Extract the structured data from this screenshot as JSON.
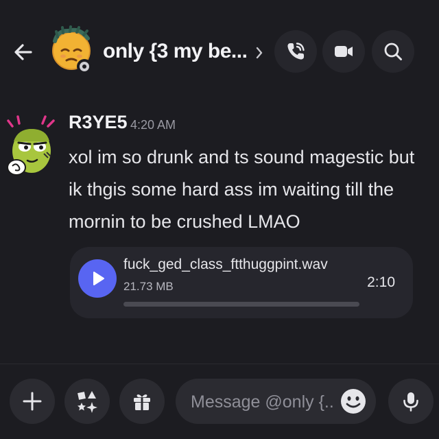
{
  "header": {
    "back_icon": "arrow-left-icon",
    "title": "only {3 my be...",
    "title_chevron_icon": "chevron-right-icon",
    "actions": [
      {
        "name": "voice-call",
        "icon": "phone-call-icon"
      },
      {
        "name": "video-call",
        "icon": "video-camera-icon"
      },
      {
        "name": "search",
        "icon": "search-icon"
      }
    ],
    "status": "idle"
  },
  "message": {
    "author": "R3YE5",
    "timestamp": "4:20 AM",
    "text": "xol im so drunk and ts sound magestic but ik thgis some hard ass im waiting till the mornin to be crushed LMAO",
    "attachment": {
      "type": "audio",
      "file_name": "fuck_ged_class_ftthuggpint.wav",
      "file_size": "21.73 MB",
      "duration": "2:10",
      "progress": 0,
      "play_icon": "play-icon"
    }
  },
  "composer": {
    "placeholder": "Message @only {...",
    "buttons": [
      {
        "name": "add",
        "icon": "plus-icon"
      },
      {
        "name": "apps",
        "icon": "apps-icon"
      },
      {
        "name": "gift",
        "icon": "gift-icon"
      },
      {
        "name": "voice-message",
        "icon": "microphone-icon"
      }
    ],
    "emoji_icon": "smiley-emoji-icon"
  },
  "colors": {
    "background": "#1c1c21",
    "surface": "#26262c",
    "accent": "#5865f2",
    "text_primary": "#f2f2f5",
    "text_muted": "#9a9aa3"
  }
}
